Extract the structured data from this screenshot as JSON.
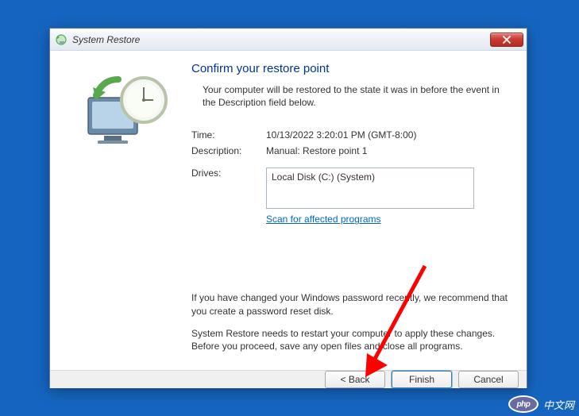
{
  "window": {
    "title": "System Restore"
  },
  "heading": "Confirm your restore point",
  "intro": "Your computer will be restored to the state it was in before the event in the Description field below.",
  "fields": {
    "time_label": "Time:",
    "time_value": "10/13/2022 3:20:01 PM (GMT-8:00)",
    "description_label": "Description:",
    "description_value": "Manual: Restore point 1",
    "drives_label": "Drives:",
    "drives_value": "Local Disk (C:) (System)"
  },
  "scan_link": "Scan for affected programs",
  "warnings": {
    "password": "If you have changed your Windows password recently, we recommend that you create a password reset disk.",
    "restart": "System Restore needs to restart your computer to apply these changes. Before you proceed, save any open files and close all programs."
  },
  "buttons": {
    "back": "< Back",
    "finish": "Finish",
    "cancel": "Cancel"
  },
  "watermark": "中文网"
}
